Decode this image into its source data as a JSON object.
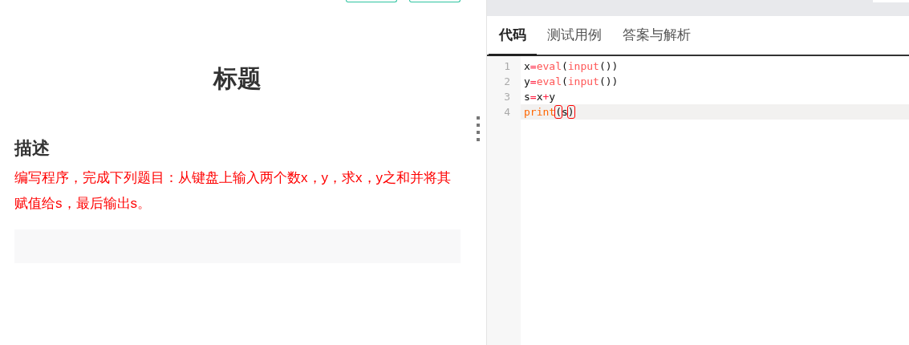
{
  "problem": {
    "title": "标题",
    "section_heading": "描述",
    "description": "编写程序，完成下列题目：从键盘上输入两个数x，y，求x，y之和并将其赋值给s，最后输出s。"
  },
  "tabs": [
    {
      "label": "代码",
      "selected": true
    },
    {
      "label": "测试用例",
      "selected": false
    },
    {
      "label": "答案与解析",
      "selected": false
    }
  ],
  "editor": {
    "lines": [
      {
        "number": "1",
        "active": false,
        "tokens": [
          {
            "kind": "plain",
            "text": "x"
          },
          {
            "kind": "op",
            "text": "="
          },
          {
            "kind": "builtin",
            "text": "eval"
          },
          {
            "kind": "paren",
            "text": "("
          },
          {
            "kind": "builtin",
            "text": "input"
          },
          {
            "kind": "plain",
            "text": "())"
          }
        ]
      },
      {
        "number": "2",
        "active": false,
        "tokens": [
          {
            "kind": "plain",
            "text": "y"
          },
          {
            "kind": "op",
            "text": "="
          },
          {
            "kind": "builtin",
            "text": "eval"
          },
          {
            "kind": "paren",
            "text": "("
          },
          {
            "kind": "builtin",
            "text": "input"
          },
          {
            "kind": "plain",
            "text": "())"
          }
        ]
      },
      {
        "number": "3",
        "active": false,
        "tokens": [
          {
            "kind": "plain",
            "text": "s"
          },
          {
            "kind": "op",
            "text": "="
          },
          {
            "kind": "plain",
            "text": "x"
          },
          {
            "kind": "op",
            "text": "+"
          },
          {
            "kind": "plain",
            "text": "y"
          }
        ]
      },
      {
        "number": "4",
        "active": true,
        "tokens": [
          {
            "kind": "keyword",
            "text": "print"
          },
          {
            "kind": "match",
            "text": "("
          },
          {
            "kind": "plain",
            "text": "s"
          },
          {
            "kind": "match",
            "text": ")"
          }
        ]
      }
    ]
  }
}
